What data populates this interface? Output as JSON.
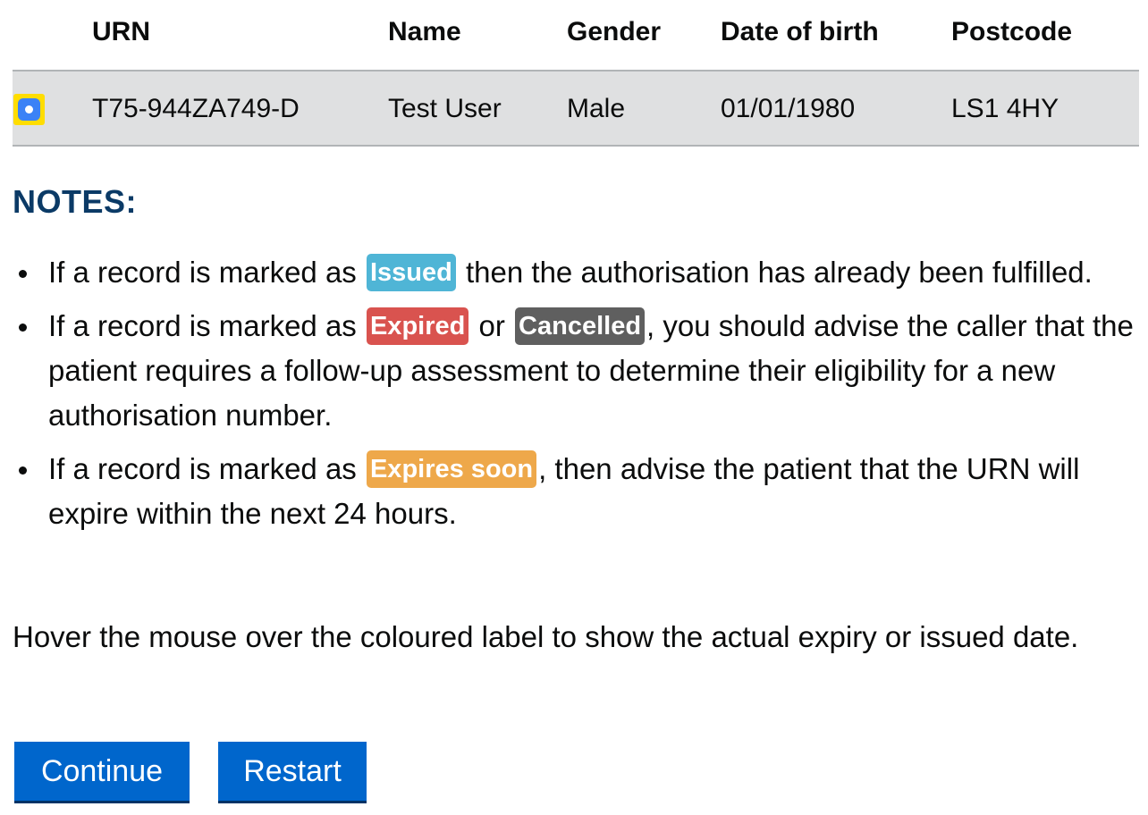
{
  "table": {
    "headers": {
      "urn": "URN",
      "name": "Name",
      "gender": "Gender",
      "dob": "Date of birth",
      "postcode": "Postcode"
    },
    "rows": [
      {
        "selected": true,
        "urn": "T75-944ZA749-D",
        "name": "Test User",
        "gender": "Male",
        "dob": "01/01/1980",
        "postcode": "LS1 4HY"
      }
    ]
  },
  "notes": {
    "heading": "NOTES:",
    "items": [
      {
        "before": "If a record is marked as ",
        "tag": "Issued",
        "after": " then the authorisation has already been fulfilled."
      },
      {
        "before": "If a record is marked as ",
        "tag": "Expired",
        "middle": " or ",
        "tag2": "Cancelled",
        "after": ", you should advise the caller that the patient requires a follow-up assessment to determine their eligibility for a new authorisation number."
      },
      {
        "before": "If a record is marked as ",
        "tag": "Expires soon",
        "after": ", then advise the patient that the URN will expire within the next 24 hours."
      }
    ]
  },
  "hover_text": "Hover the mouse over the coloured label to show the actual expiry or issued date.",
  "buttons": {
    "continue": "Continue",
    "restart": "Restart"
  },
  "colors": {
    "issued": "#4fb5d6",
    "expired": "#d9534f",
    "cancelled": "#5f5f5f",
    "expires_soon": "#eea84a",
    "button": "#0066cc",
    "heading": "#0b3a66",
    "selected_row": "#dfe0e1"
  }
}
